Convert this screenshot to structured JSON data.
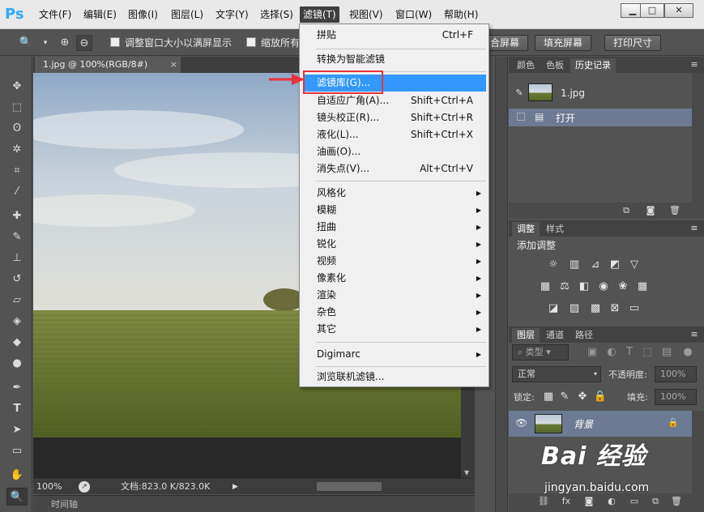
{
  "app": {
    "logo": "Ps"
  },
  "menubar": {
    "items": [
      "文件(F)",
      "编辑(E)",
      "图像(I)",
      "图层(L)",
      "文字(Y)",
      "选择(S)",
      "滤镜(T)",
      "视图(V)",
      "窗口(W)",
      "帮助(H)"
    ],
    "active": "滤镜(T)"
  },
  "options": {
    "fit_window_label": "调整窗口大小以满屏显示",
    "zoom_all_label": "缩放所有",
    "fill_screen_partial": "合屏幕",
    "fill_screen_btn": "填充屏幕",
    "print_size_btn": "打印尺寸"
  },
  "document": {
    "tab_title": "1.jpg @ 100%(RGB/8#)",
    "tab_close": "×",
    "zoom": "100%",
    "doc_info": "文档:823.0 K/823.0K",
    "timeline_label": "时间轴"
  },
  "filter_menu": {
    "items": [
      {
        "label": "拼贴",
        "shortcut": "Ctrl+F"
      },
      {
        "label": "转换为智能滤镜",
        "shortcut": ""
      },
      {
        "label": "滤镜库(G)...",
        "shortcut": ""
      },
      {
        "label": "自适应广角(A)...",
        "shortcut": "Shift+Ctrl+A"
      },
      {
        "label": "镜头校正(R)...",
        "shortcut": "Shift+Ctrl+R"
      },
      {
        "label": "液化(L)...",
        "shortcut": "Shift+Ctrl+X"
      },
      {
        "label": "油画(O)...",
        "shortcut": ""
      },
      {
        "label": "消失点(V)...",
        "shortcut": "Alt+Ctrl+V"
      },
      {
        "label": "风格化",
        "shortcut": ""
      },
      {
        "label": "模糊",
        "shortcut": ""
      },
      {
        "label": "扭曲",
        "shortcut": ""
      },
      {
        "label": "锐化",
        "shortcut": ""
      },
      {
        "label": "视频",
        "shortcut": ""
      },
      {
        "label": "像素化",
        "shortcut": ""
      },
      {
        "label": "渲染",
        "shortcut": ""
      },
      {
        "label": "杂色",
        "shortcut": ""
      },
      {
        "label": "其它",
        "shortcut": ""
      },
      {
        "label": "Digimarc",
        "shortcut": ""
      },
      {
        "label": "浏览联机滤镜...",
        "shortcut": ""
      }
    ],
    "highlighted": "滤镜库(G)..."
  },
  "history_panel": {
    "tabs": [
      "颜色",
      "色板",
      "历史记录"
    ],
    "active_tab": "历史记录",
    "snapshot_name": "1.jpg",
    "step_name": "打开"
  },
  "adjustments_panel": {
    "tabs": [
      "调整",
      "样式"
    ],
    "active_tab": "调整",
    "title": "添加调整"
  },
  "layers_panel": {
    "tabs": [
      "图层",
      "通道",
      "路径"
    ],
    "active_tab": "图层",
    "filter_kind": "类型",
    "blend_mode": "正常",
    "opacity_label": "不透明度:",
    "opacity_value": "100%",
    "lock_label": "锁定:",
    "fill_label": "填充:",
    "fill_value": "100%",
    "layer_name": "背景"
  },
  "watermark": {
    "logo": "Bai 经验",
    "url": "jingyan.baidu.com"
  },
  "colors": {
    "menu_highlight": "#3399ff",
    "annotation_red": "#e8323c",
    "ps_blue": "#2fa8ff"
  }
}
